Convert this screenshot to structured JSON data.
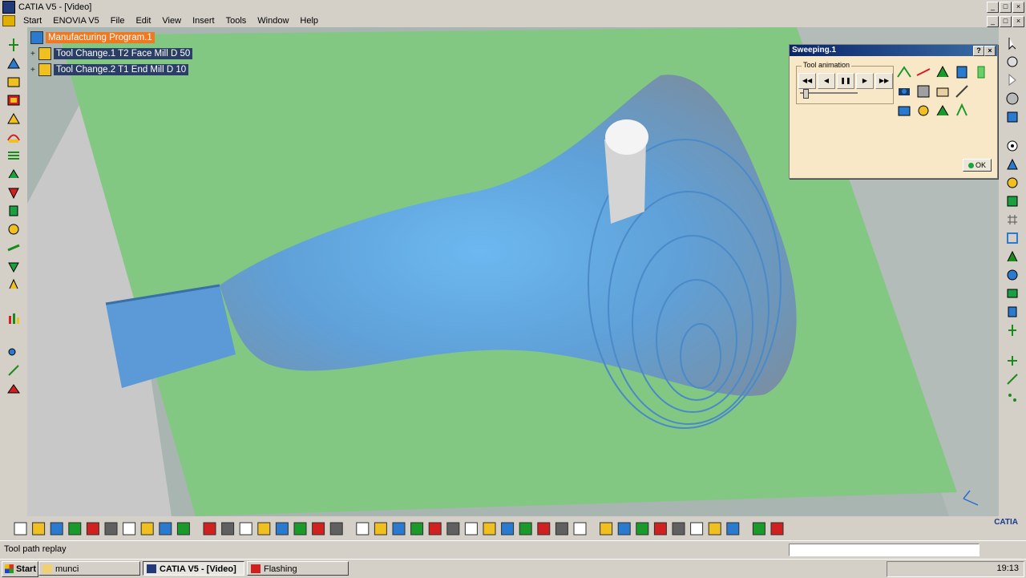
{
  "window": {
    "title": "CATIA V5 - [Video]",
    "controls": [
      "_",
      "□",
      "×"
    ]
  },
  "menu": {
    "items": [
      "Start",
      "ENOVIA V5",
      "File",
      "Edit",
      "View",
      "Insert",
      "Tools",
      "Window",
      "Help"
    ]
  },
  "tree": {
    "root": "Manufacturing Program.1",
    "children": [
      {
        "label": "Tool Change.1  T2 Face Mill D 50"
      },
      {
        "label": "Tool Change.2  T1 End Mill D 10"
      }
    ]
  },
  "dialog": {
    "title": "Sweeping.1",
    "help": "?",
    "close": "×",
    "group_label": "Tool animation",
    "player_buttons": [
      "rewind",
      "step-back",
      "pause",
      "step-forward",
      "fast-forward"
    ],
    "ok_label": "OK",
    "progress": 0.05
  },
  "status": {
    "text": "Tool path replay"
  },
  "taskbar": {
    "start": "Start",
    "tasks": [
      {
        "label": "munci",
        "active": false
      },
      {
        "label": "CATIA V5 - [Video]",
        "active": true
      },
      {
        "label": "Flashing",
        "active": false
      }
    ],
    "clock": "19:13"
  },
  "brand": "CATIA",
  "colors": {
    "stock": "#82c882",
    "part": "#5fa0d8",
    "tree_highlight": "#2a3e66",
    "tree_root": "#f07820",
    "dialog_bg": "#f8e8c8"
  }
}
